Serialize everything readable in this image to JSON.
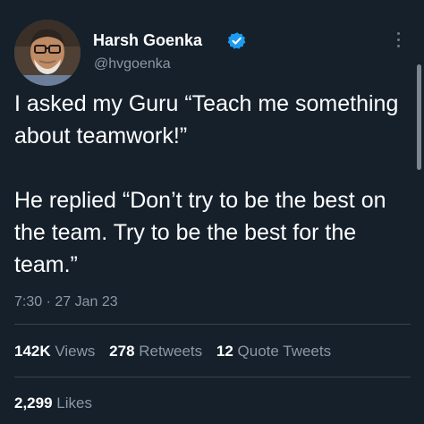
{
  "author": {
    "name": "Harsh Goenka",
    "handle": "@hvgoenka",
    "verified": true,
    "verified_color": "#1d9bf0"
  },
  "icons": {
    "more": "more-vertical-icon",
    "verified": "verified-badge-icon",
    "avatar": "avatar"
  },
  "tweet": {
    "paragraph_1": "I asked my Guru “Teach me something about teamwork!”",
    "paragraph_2": "He replied “Don’t try to be the best on the team. Try to be the best for the team.”",
    "time": "7:30",
    "separator": "·",
    "date": "27 Jan 23"
  },
  "stats": {
    "views_count": "142K",
    "views_label": "Views",
    "retweets_count": "278",
    "retweets_label": "Retweets",
    "quotes_count": "12",
    "quotes_label": "Quote Tweets",
    "likes_count": "2,299",
    "likes_label": "Likes"
  },
  "colors": {
    "background": "#15202b",
    "primary_text": "#ffffff",
    "secondary_text": "#8b98a5",
    "divider": "#38444d"
  }
}
